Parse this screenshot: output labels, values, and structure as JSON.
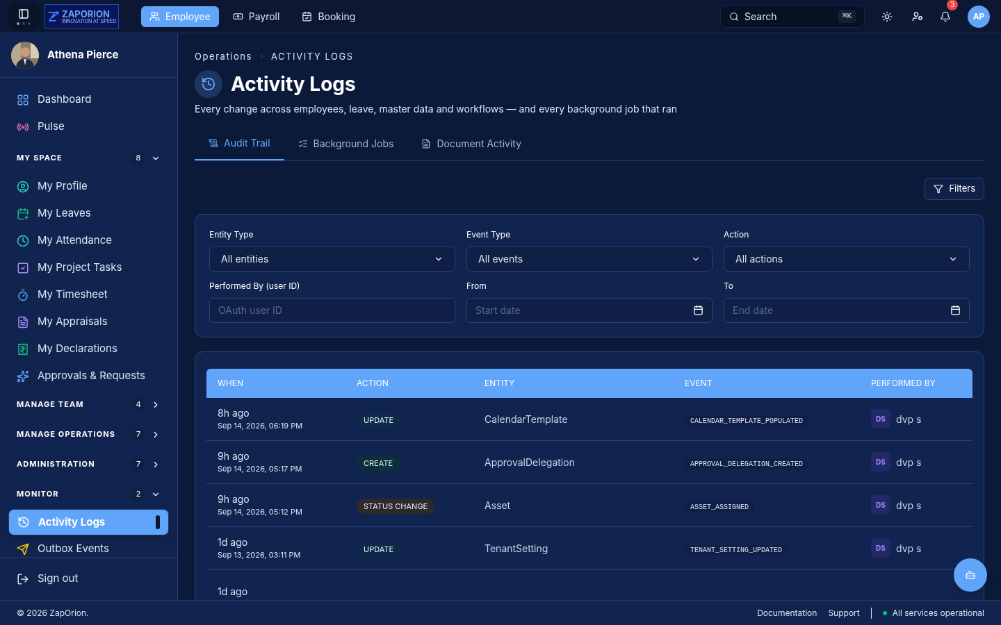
{
  "topbar": {
    "logo": {
      "name": "ZAPORION",
      "tagline": "INNOVATION AT SPEED"
    },
    "nav": [
      {
        "label": "Employee",
        "selected": true
      },
      {
        "label": "Payroll",
        "selected": false
      },
      {
        "label": "Booking",
        "selected": false
      }
    ],
    "search": {
      "placeholder": "Search",
      "shortcut": "⌘K"
    },
    "notifications": "3",
    "avatar": "AP"
  },
  "sidebar": {
    "user": "Athena Pierce",
    "items": [
      {
        "label": "Dashboard",
        "selected": false
      },
      {
        "label": "Pulse",
        "selected": false
      }
    ],
    "sections": [
      {
        "title": "MY SPACE",
        "count": "8",
        "expanded": true,
        "items": [
          {
            "label": "My Profile",
            "selected": false
          },
          {
            "label": "My Leaves",
            "selected": false
          },
          {
            "label": "My Attendance",
            "selected": false
          },
          {
            "label": "My Project Tasks",
            "selected": false
          },
          {
            "label": "My Timesheet",
            "selected": false
          },
          {
            "label": "My Appraisals",
            "selected": false
          },
          {
            "label": "My Declarations",
            "selected": false
          },
          {
            "label": "Approvals & Requests",
            "selected": false
          }
        ]
      },
      {
        "title": "MANAGE TEAM",
        "count": "4",
        "expanded": false
      },
      {
        "title": "MANAGE OPERATIONS",
        "count": "7",
        "expanded": false
      },
      {
        "title": "ADMINISTRATION",
        "count": "7",
        "expanded": false
      },
      {
        "title": "MONITOR",
        "count": "2",
        "expanded": true,
        "items": [
          {
            "label": "Activity Logs",
            "selected": true
          },
          {
            "label": "Outbox Events",
            "selected": false
          }
        ]
      }
    ],
    "sign_out": "Sign out"
  },
  "breadcrumb": [
    "Operations",
    "ACTIVITY LOGS"
  ],
  "title": "Activity Logs",
  "subtitle": "Every change across employees, leave, master data and workflows — and every background job that ran",
  "tabs": [
    {
      "label": "Audit Trail",
      "selected": true
    },
    {
      "label": "Background Jobs",
      "selected": false
    },
    {
      "label": "Document Activity",
      "selected": false
    }
  ],
  "filters_button": "Filters",
  "filters": [
    {
      "label": "Entity Type",
      "kind": "select",
      "value": "All entities"
    },
    {
      "label": "Event Type",
      "kind": "select",
      "value": "All events"
    },
    {
      "label": "Action",
      "kind": "select",
      "value": "All actions"
    },
    {
      "label": "Performed By (user ID)",
      "kind": "input",
      "placeholder": "OAuth user ID"
    },
    {
      "label": "From",
      "kind": "date",
      "placeholder": "Start date"
    },
    {
      "label": "To",
      "kind": "date",
      "placeholder": "End date"
    }
  ],
  "table": {
    "columns": [
      "WHEN",
      "ACTION",
      "ENTITY",
      "EVENT",
      "PERFORMED BY"
    ],
    "rows": [
      {
        "ago": "8h ago",
        "date": "Sep 14, 2026, 06:19 PM",
        "action": {
          "label": "UPDATE",
          "color": "#0e2a4a"
        },
        "entity": "CalendarTemplate",
        "event": "CALENDAR_TEMPLATE_POPULATED",
        "initials": "DS",
        "user": "dvp s"
      },
      {
        "ago": "9h ago",
        "date": "Sep 14, 2026, 05:17 PM",
        "action": {
          "label": "CREATE",
          "color": "#0c2f3a"
        },
        "entity": "ApprovalDelegation",
        "event": "APPROVAL_DELEGATION_CREATED",
        "initials": "DS",
        "user": "dvp s"
      },
      {
        "ago": "9h ago",
        "date": "Sep 14, 2026, 05:12 PM",
        "action": {
          "label": "STATUS CHANGE",
          "color": "#2e2a2c"
        },
        "entity": "Asset",
        "event": "ASSET_ASSIGNED",
        "initials": "DS",
        "user": "dvp s"
      },
      {
        "ago": "1d ago",
        "date": "Sep 13, 2026, 03:11 PM",
        "action": {
          "label": "UPDATE",
          "color": "#0e2a4a"
        },
        "entity": "TenantSetting",
        "event": "TENANT_SETTING_UPDATED",
        "initials": "DS",
        "user": "dvp s"
      },
      {
        "ago": "1d ago"
      }
    ]
  },
  "footer": {
    "copyright": "© 2026 ZapOrion.",
    "links": [
      "Documentation",
      "Support"
    ],
    "status": "All services operational"
  }
}
